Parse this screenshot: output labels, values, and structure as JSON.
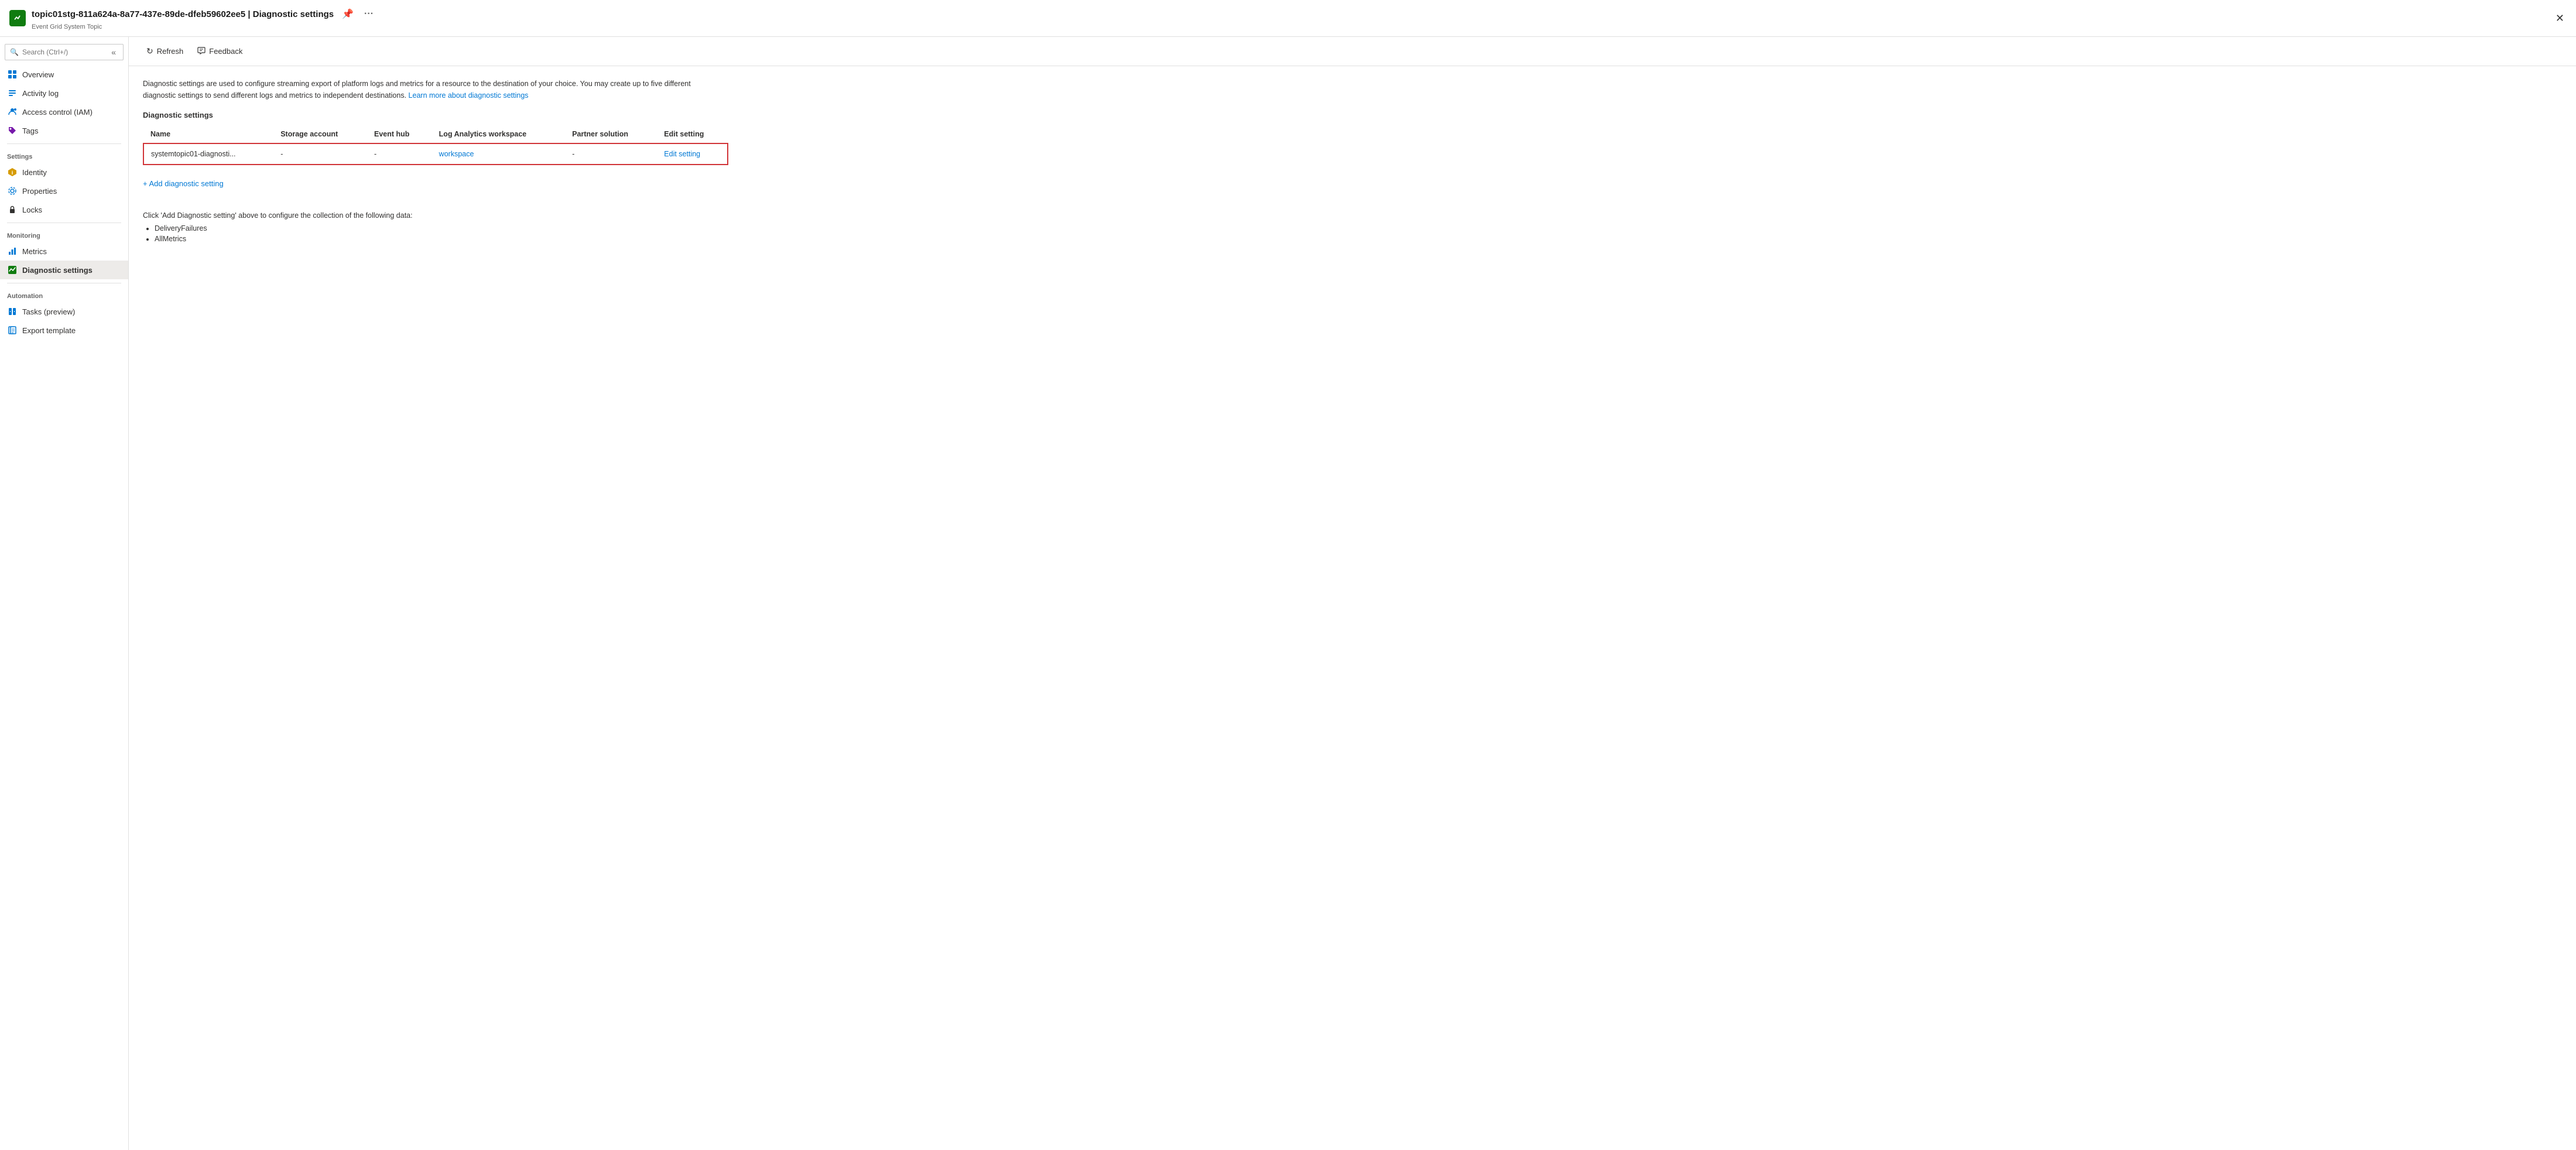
{
  "titleBar": {
    "title": "topic01stg-811a624a-8a77-437e-89de-dfeb59602ee5 | Diagnostic settings",
    "subtitle": "Event Grid System Topic",
    "pinIcon": "📌",
    "moreIcon": "···",
    "closeIcon": "✕"
  },
  "sidebar": {
    "searchPlaceholder": "Search (Ctrl+/)",
    "collapseIcon": "«",
    "items": [
      {
        "id": "overview",
        "label": "Overview",
        "icon": "overview"
      },
      {
        "id": "activity-log",
        "label": "Activity log",
        "icon": "activity"
      },
      {
        "id": "access-control",
        "label": "Access control (IAM)",
        "icon": "iam"
      },
      {
        "id": "tags",
        "label": "Tags",
        "icon": "tags"
      }
    ],
    "sections": [
      {
        "label": "Settings",
        "items": [
          {
            "id": "identity",
            "label": "Identity",
            "icon": "identity"
          },
          {
            "id": "properties",
            "label": "Properties",
            "icon": "properties"
          },
          {
            "id": "locks",
            "label": "Locks",
            "icon": "locks"
          }
        ]
      },
      {
        "label": "Monitoring",
        "items": [
          {
            "id": "metrics",
            "label": "Metrics",
            "icon": "metrics"
          },
          {
            "id": "diagnostic-settings",
            "label": "Diagnostic settings",
            "icon": "diagnostic",
            "active": true
          }
        ]
      },
      {
        "label": "Automation",
        "items": [
          {
            "id": "tasks",
            "label": "Tasks (preview)",
            "icon": "tasks"
          },
          {
            "id": "export-template",
            "label": "Export template",
            "icon": "export"
          }
        ]
      }
    ]
  },
  "toolbar": {
    "refreshLabel": "Refresh",
    "feedbackLabel": "Feedback"
  },
  "content": {
    "description": "Diagnostic settings are used to configure streaming export of platform logs and metrics for a resource to the destination of your choice. You may create up to five different diagnostic settings to send different logs and metrics to independent destinations.",
    "learnMoreText": "Learn more about diagnostic settings",
    "learnMoreUrl": "#",
    "sectionTitle": "Diagnostic settings",
    "tableHeaders": {
      "name": "Name",
      "storageAccount": "Storage account",
      "eventHub": "Event hub",
      "logAnalytics": "Log Analytics workspace",
      "partnerSolution": "Partner solution",
      "editSetting": "Edit setting"
    },
    "tableRows": [
      {
        "name": "systemtopic01-diagnosti...",
        "storageAccount": "-",
        "eventHub": "-",
        "logAnalytics": "workspace",
        "partnerSolution": "-",
        "editSetting": "Edit setting"
      }
    ],
    "addSettingLabel": "+ Add diagnostic setting",
    "clickInfoText": "Click 'Add Diagnostic setting' above to configure the collection of the following data:",
    "bulletItems": [
      "DeliveryFailures",
      "AllMetrics"
    ]
  }
}
